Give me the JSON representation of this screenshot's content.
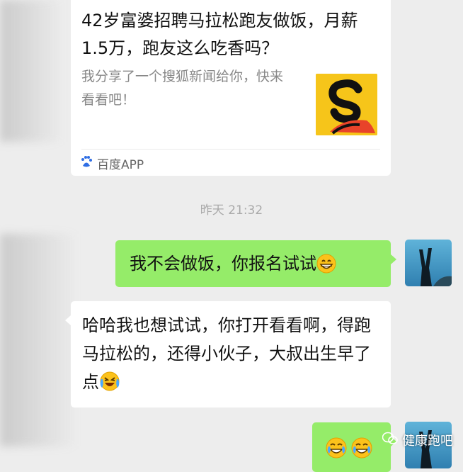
{
  "card": {
    "title": "42岁富婆招聘马拉松跑友做饭，月薪1.5万，跑友这么吃香吗？",
    "description": "我分享了一个搜狐新闻给你，快来看看吧！",
    "thumbnail_icon": "sohu-logo",
    "source_icon": "baidu-paw-icon",
    "source_label": "百度APP"
  },
  "timestamp": "昨天 21:32",
  "messages": [
    {
      "direction": "out",
      "text": "我不会做饭，你报名试试",
      "emoji": "grinning-face-emoji"
    },
    {
      "direction": "in",
      "text": "哈哈我也想试试，你打开看看啊，得跑马拉松的，还得小伙子，大叔出生早了点",
      "emoji": "laughing-crying-emoji"
    },
    {
      "direction": "out",
      "text": "",
      "emoji": "tears-of-joy-emoji x2"
    }
  ],
  "watermark": {
    "icon": "wechat-icon",
    "text": "健康跑吧"
  },
  "colors": {
    "background": "#ededed",
    "outgoing_bubble": "#95ec69",
    "incoming_bubble": "#ffffff",
    "thumbnail_bg": "#f6c51a"
  }
}
